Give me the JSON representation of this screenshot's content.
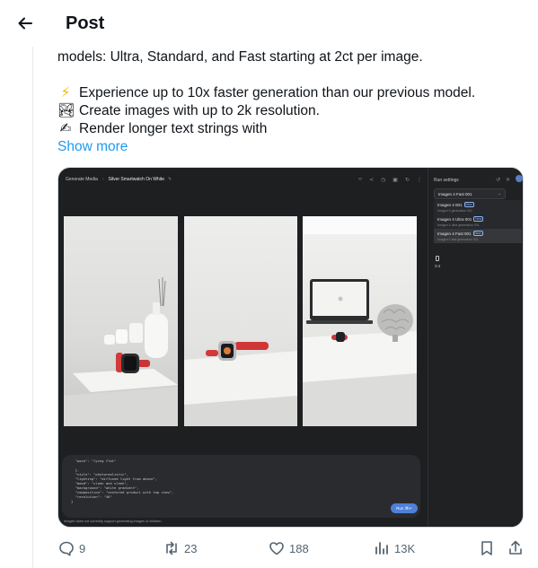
{
  "header": {
    "title": "Post"
  },
  "post": {
    "line1": "models: Ultra, Standard, and Fast starting at 2ct per image.",
    "bullets": [
      {
        "emoji": "⚡",
        "text": "Experience up to 10x faster generation than our previous model."
      },
      {
        "emoji": "🏞",
        "text": "Create images with up to 2k resolution."
      },
      {
        "emoji": "✍",
        "text": "Render longer text strings with"
      }
    ],
    "show_more": "Show more"
  },
  "media": {
    "breadcrumb_root": "Generate Media",
    "breadcrumb_current": "Silver Smartwatch On White",
    "panel_title": "Run settings",
    "selected_model": "Imagen 4 Fast 001",
    "models": [
      {
        "name": "Imagen 4 001",
        "badge": "New",
        "sub": "Imagen 4 generation 001"
      },
      {
        "name": "Imagen 4 Ultra 001",
        "badge": "New",
        "sub": "Imagen 4 ultra generation 001"
      },
      {
        "name": "Imagen 4 Fast 001",
        "badge": "New",
        "sub": "Imagen 4 fast generation 001"
      }
    ],
    "aspect_ratio": "3:4",
    "prompt": "  \"pose\": \"lying flat\"\n\n  },\n  \"style\": \"photorealistic\",\n  \"lighting\": \"diffused light from above\",\n  \"mood\": \"clean and sleek\",\n  \"background\": \"white gradient\",\n  \"composition\": \"centered product with top view\",\n  \"resolution\": \"4K\"\n}",
    "run_label": "Run ⌘↵",
    "disclaimer": "Imagen does not currently support generating images of children."
  },
  "actions": {
    "replies": "9",
    "reposts": "23",
    "likes": "188",
    "views": "13K"
  },
  "colors": {
    "link": "#1d9bf0",
    "icon": "#536471",
    "text": "#0f1419"
  }
}
